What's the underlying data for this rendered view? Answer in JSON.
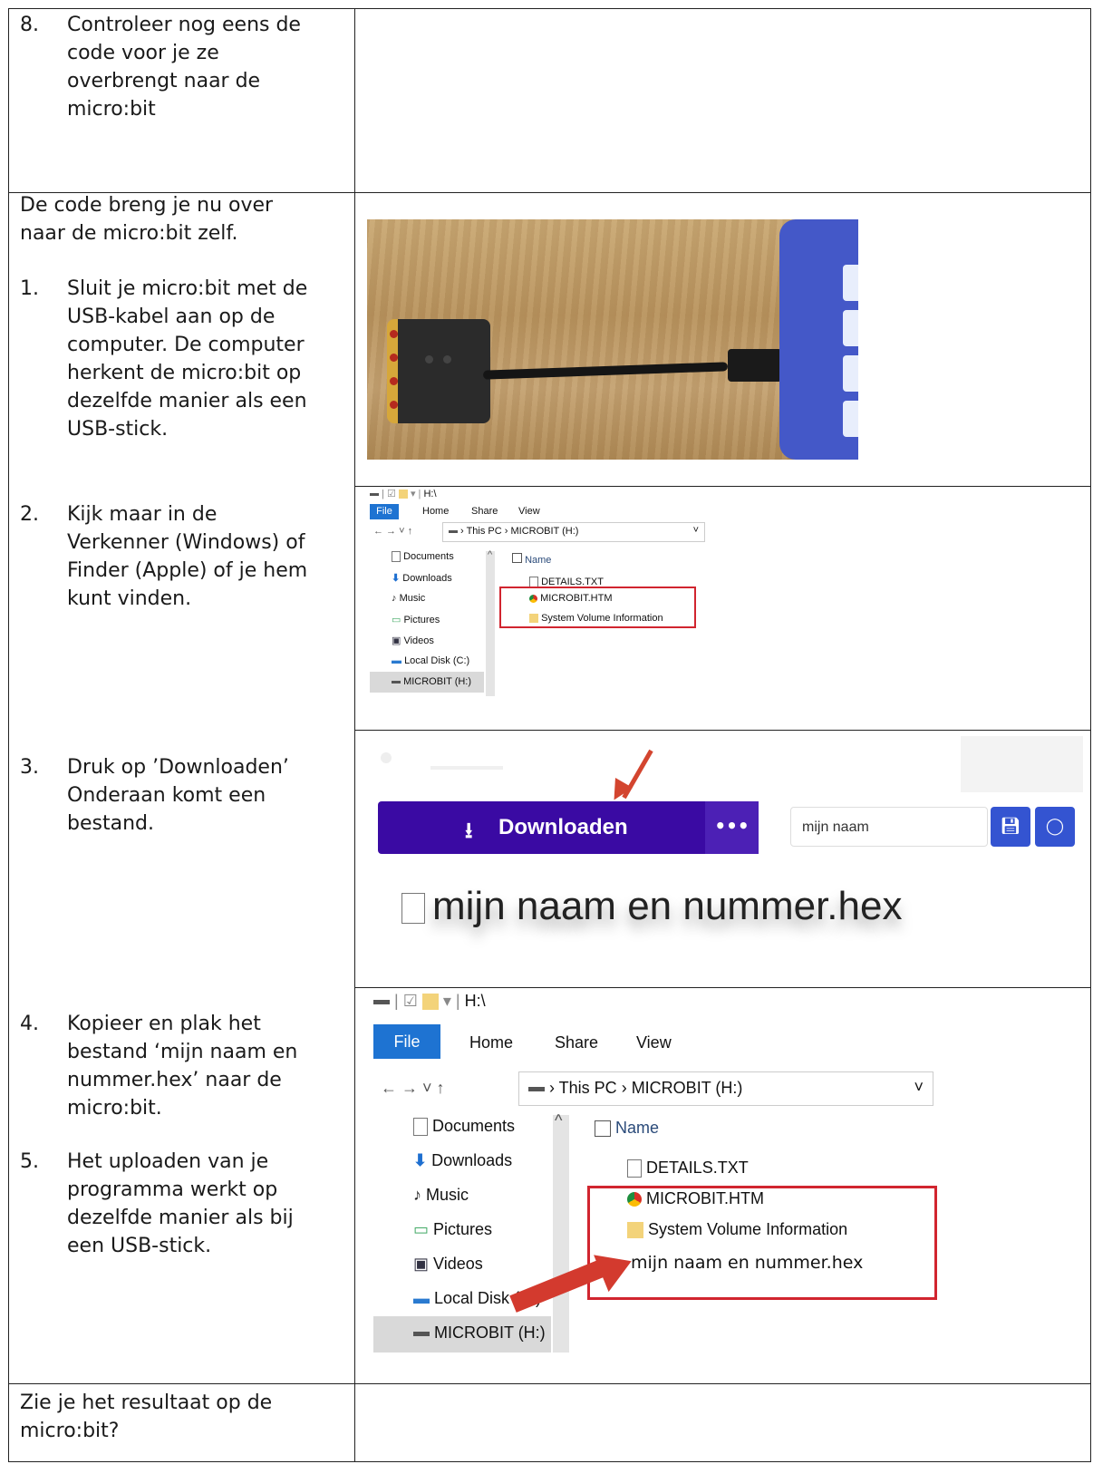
{
  "rows": {
    "step8": {
      "num": "8.",
      "lines": [
        "Controleer nog eens de",
        "code voor je ze",
        "overbrengt naar de",
        "micro:bit"
      ]
    },
    "intro": {
      "lines": [
        "De code breng je nu over",
        "naar de micro:bit zelf."
      ]
    },
    "step1": {
      "num": "1.",
      "lines": [
        "Sluit je micro:bit met de",
        "USB-kabel aan op de",
        "computer. De computer",
        "herkent de micro:bit op",
        "dezelfde manier als een",
        "USB-stick."
      ]
    },
    "step2": {
      "num": "2.",
      "lines": [
        "Kijk maar in de",
        "Verkenner (Windows) of",
        "Finder (Apple) of je hem",
        "kunt vinden."
      ]
    },
    "step3": {
      "num": "3.",
      "lines": [
        "Druk op ’Downloaden’",
        "Onderaan komt een",
        "bestand."
      ]
    },
    "step4": {
      "num": "4.",
      "lines": [
        "Kopieer en plak het",
        "bestand ‘mijn naam en",
        "nummer.hex’ naar de",
        "micro:bit."
      ]
    },
    "step5": {
      "num": "5.",
      "lines": [
        "Het uploaden van je",
        "programma werkt op",
        "dezelfde manier als bij",
        "een USB-stick."
      ]
    },
    "final": {
      "lines": [
        "Zie je het resultaat op de",
        "micro:bit?"
      ]
    }
  },
  "explorer": {
    "title": "H:\\",
    "ribbon": [
      "File",
      "Home",
      "Share",
      "View"
    ],
    "path": [
      "This PC",
      "MICROBIT (H:)"
    ],
    "nav": [
      "Documents",
      "Downloads",
      "Music",
      "Pictures",
      "Videos",
      "Local Disk (C:)",
      "MICROBIT (H:)"
    ],
    "column": "Name",
    "files": [
      "DETAILS.TXT",
      "MICROBIT.HTM",
      "System Volume Information"
    ],
    "pasted_file": "mijn naam en nummer.hex"
  },
  "download_panel": {
    "button": "Downloaden",
    "more": "•••",
    "name_input": "mijn naam",
    "file_result": "mijn naam en nummer.hex"
  },
  "icons": [
    "download-icon",
    "save-icon",
    "github-icon",
    "document-icon",
    "folder-icon",
    "chrome-icon",
    "music-icon",
    "disk-icon"
  ],
  "colors": {
    "download_button": "#3a0aa3",
    "explorer_file_tab": "#1e73d2",
    "highlight_box": "#d1252f"
  }
}
